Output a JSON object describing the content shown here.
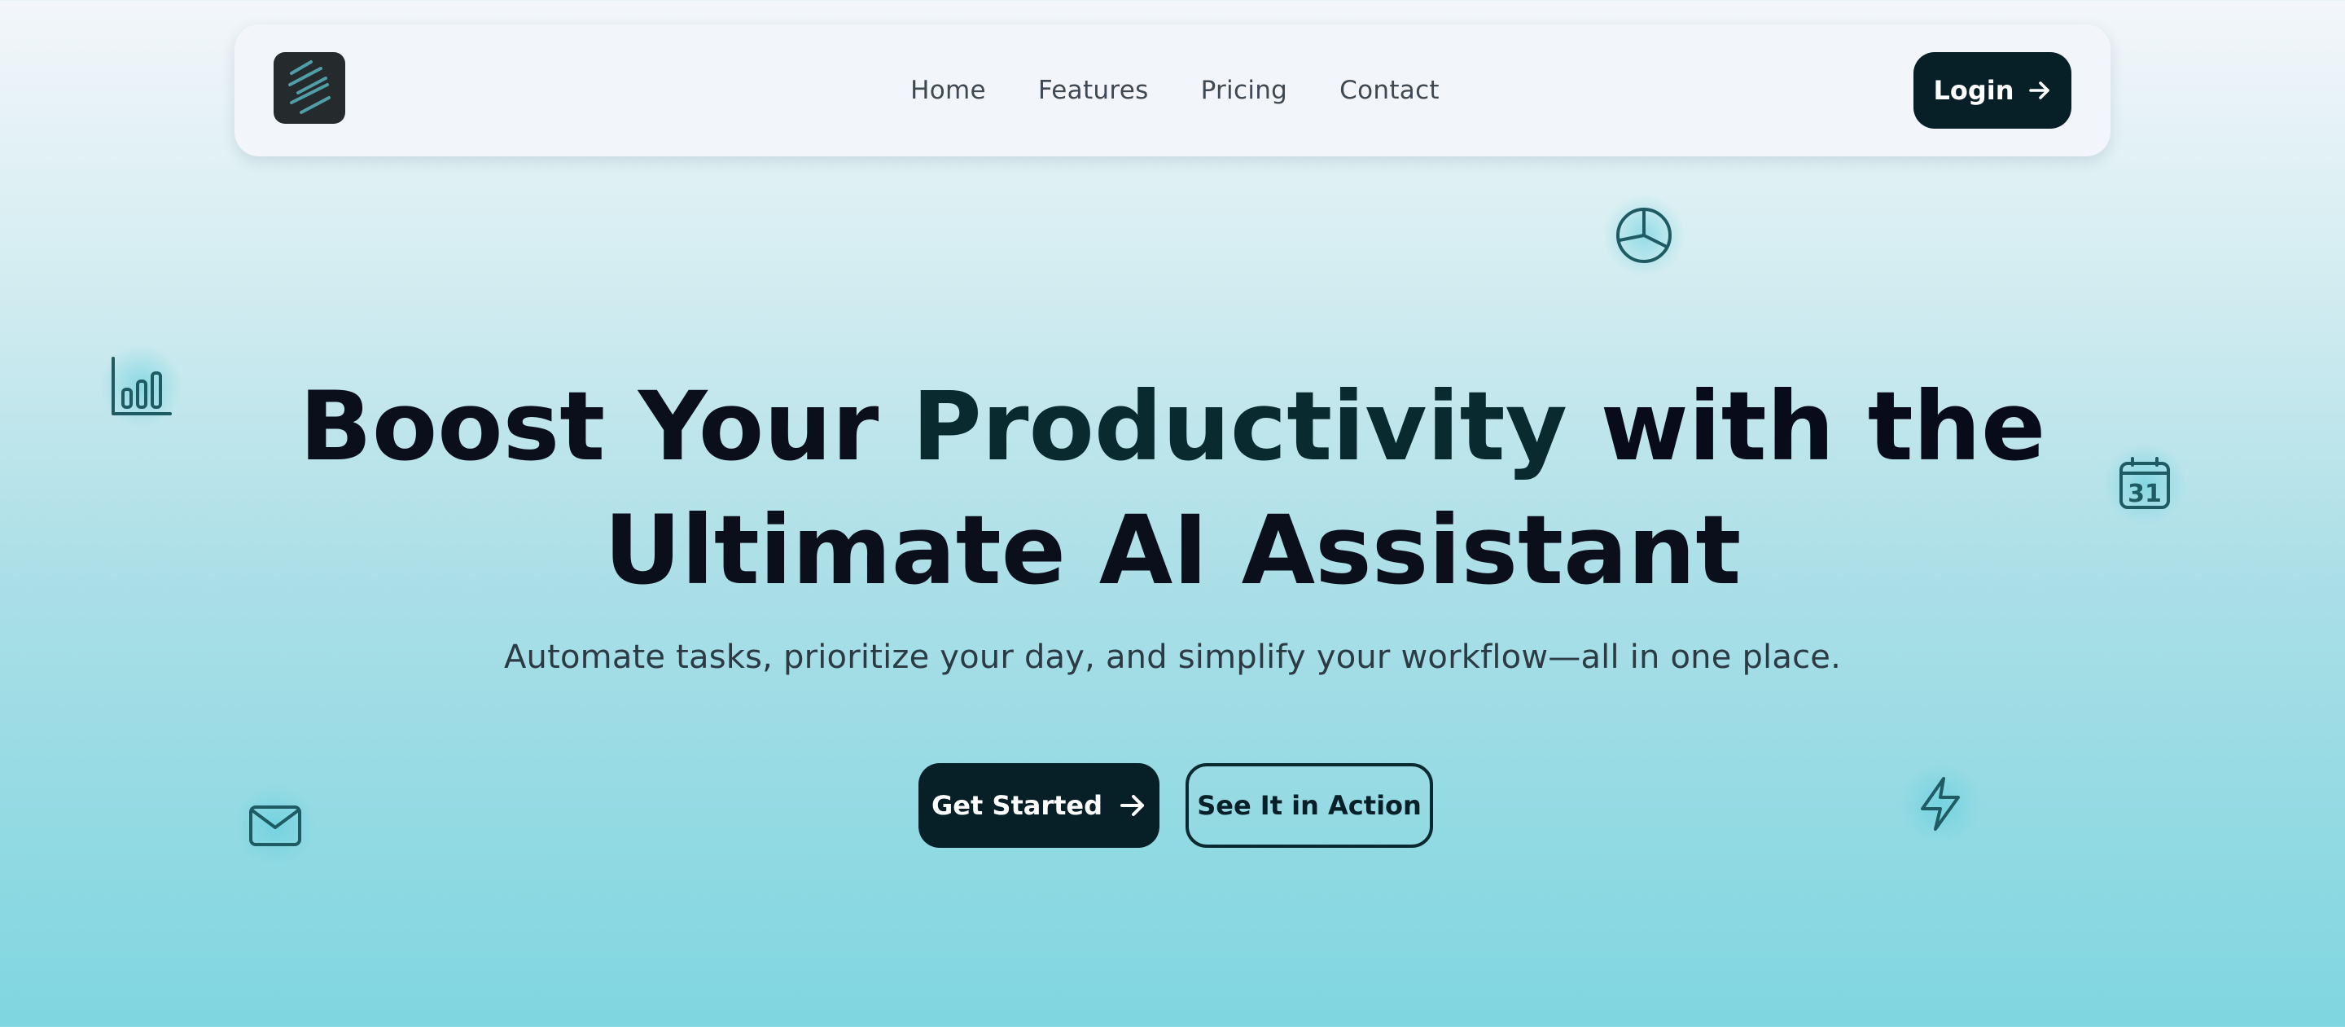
{
  "nav": {
    "logo_icon": "stripes-logo-icon",
    "links": [
      {
        "label": "Home"
      },
      {
        "label": "Features"
      },
      {
        "label": "Pricing"
      },
      {
        "label": "Contact"
      }
    ],
    "login_label": "Login",
    "login_icon": "arrow-right-icon"
  },
  "hero": {
    "title_line1_part1": "Boost Your ",
    "title_line1_part2": "Productivity",
    "title_line1_part3": " with the",
    "title_line2": "Ultimate AI Assistant",
    "subtitle": "Automate tasks, prioritize your day, and simplify your workflow—all in one place.",
    "primary_cta": "Get Started",
    "primary_cta_icon": "arrow-right-icon",
    "secondary_cta": "See It in Action"
  },
  "floating_icons": {
    "pie": "pie-chart-icon",
    "bar": "bar-chart-icon",
    "calendar": "calendar-icon",
    "calendar_text": "31",
    "mail": "mail-icon",
    "bolt": "lightning-bolt-icon"
  },
  "colors": {
    "primary_dark": "#071f26",
    "accent_teal": "#7fd6e0",
    "icon_stroke": "#1f5b63"
  }
}
